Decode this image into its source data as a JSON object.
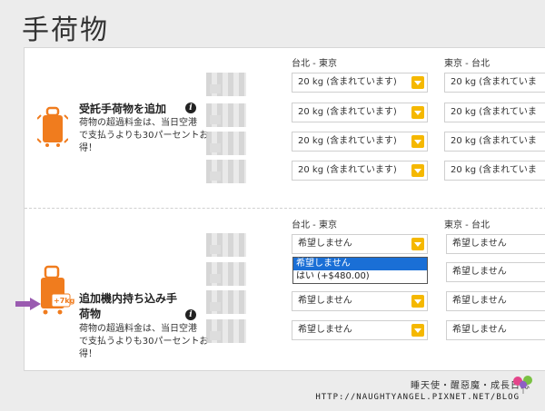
{
  "page": {
    "title": "手荷物"
  },
  "checked_baggage": {
    "title": "受託手荷物を追加",
    "description": [
      "荷物の超過料金は、当日空港",
      "で支払うよりも30パーセントお",
      "得！"
    ],
    "icon": "suitcase-icon",
    "columns": [
      {
        "header": "台北 - 東京",
        "rows": [
          "20 kg (含まれています)",
          "20 kg (含まれています)",
          "20 kg (含まれています)",
          "20 kg (含まれています)"
        ]
      },
      {
        "header": "東京 - 台北",
        "rows": [
          "20 kg (含まれていま",
          "20 kg (含まれていま",
          "20 kg (含まれていま",
          "20 kg (含まれていま"
        ]
      }
    ]
  },
  "cabin_baggage": {
    "title_lines": [
      "追加機内持ち込み手",
      "荷物"
    ],
    "description": [
      "荷物の超過料金は、当日空港",
      "で支払うよりも30パーセントお",
      "得！"
    ],
    "icon": "suitcase-plus-7kg-icon",
    "badge": "+7kg",
    "columns": [
      {
        "header": "台北 - 東京",
        "rows": [
          "希望しません",
          "希望しません",
          "希望しません",
          "希望しません"
        ]
      },
      {
        "header": "東京 - 台北",
        "rows": [
          "希望しません",
          "希望しません",
          "希望しません",
          "希望しません"
        ]
      }
    ],
    "dropdown": {
      "options": [
        "希望しません",
        "はい (+$480.00)"
      ],
      "selected": 0
    }
  },
  "watermark": {
    "line1": "睡天使・醒惡魔・成長日誌",
    "line2": "HTTP://NAUGHTYANGEL.PIXNET.NET/BLOG"
  },
  "colors": {
    "accent": "#f5b800",
    "bag_orange": "#f07c1e",
    "arrow_purple": "#9a5bb0",
    "dropdown_highlight": "#1a6fd6"
  }
}
